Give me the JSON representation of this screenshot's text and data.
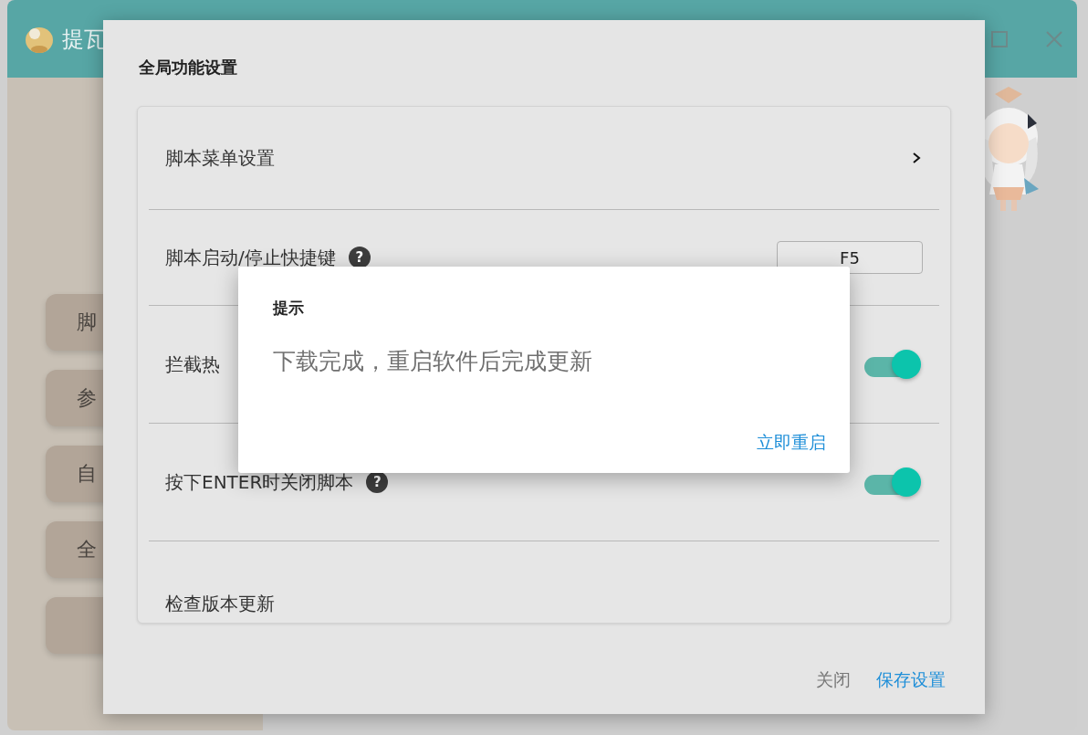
{
  "app_window": {
    "title": "提瓦",
    "sidebar_buttons": [
      {
        "kind": "text",
        "label": "脚"
      },
      {
        "kind": "text",
        "label": "参"
      },
      {
        "kind": "text",
        "label": "自"
      },
      {
        "kind": "text",
        "label": "全"
      },
      {
        "kind": "blank"
      }
    ]
  },
  "settings_dialog": {
    "title": "全局功能设置",
    "rows": [
      {
        "kind": "link",
        "label": "脚本菜单设置"
      },
      {
        "kind": "hotkey",
        "label": "脚本启动/停止快捷键",
        "help": "?",
        "value": "F5"
      },
      {
        "kind": "toggle",
        "label": "拦截热",
        "on": true
      },
      {
        "kind": "toggle",
        "label": "按下ENTER时关闭脚本",
        "help": "?",
        "on": true
      },
      {
        "kind": "plain",
        "label": "检查版本更新"
      }
    ],
    "buttons": [
      {
        "label": "关闭",
        "primary": false
      },
      {
        "label": "保存设置",
        "primary": true
      }
    ]
  },
  "alert_dialog": {
    "title": "提示",
    "message": "下载完成，重启软件后完成更新",
    "button": "立即重启"
  }
}
